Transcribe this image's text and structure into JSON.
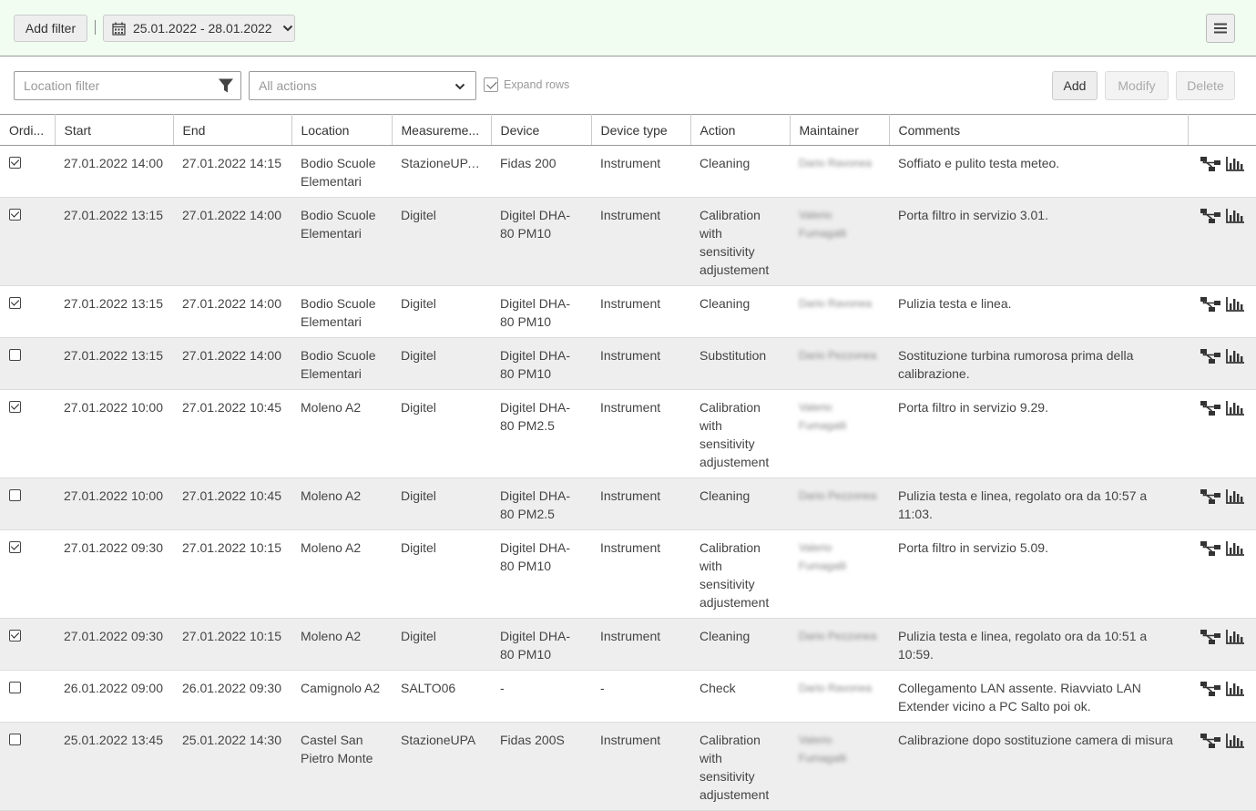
{
  "topbar": {
    "add_filter": "Add filter",
    "date_range": "25.01.2022 - 28.01.2022"
  },
  "toolbar": {
    "location_placeholder": "Location filter",
    "actions_value": "All actions",
    "expand_rows": "Expand rows",
    "add": "Add",
    "modify": "Modify",
    "delete": "Delete"
  },
  "columns": [
    "Ordi...",
    "Start",
    "End",
    "Location",
    "Measureme...",
    "Device",
    "Device type",
    "Action",
    "Maintainer",
    "Comments"
  ],
  "rows": [
    {
      "checked": true,
      "start": "27.01.2022 14:00",
      "end": "27.01.2022 14:15",
      "location": "Bodio Scuole Elementari",
      "measurement": "StazioneUPA...",
      "device": "Fidas 200",
      "device_type": "Instrument",
      "action": "Cleaning",
      "maintainer": "Dario Ravonea",
      "comments": "Soffiato e pulito testa meteo."
    },
    {
      "checked": true,
      "start": "27.01.2022 13:15",
      "end": "27.01.2022 14:00",
      "location": "Bodio Scuole Elementari",
      "measurement": "Digitel",
      "device": "Digitel DHA-80 PM10",
      "device_type": "Instrument",
      "action": "Calibration with sensitivity adjustement",
      "maintainer": "Valerio Fumagalli",
      "comments": "Porta filtro in servizio 3.01."
    },
    {
      "checked": true,
      "start": "27.01.2022 13:15",
      "end": "27.01.2022 14:00",
      "location": "Bodio Scuole Elementari",
      "measurement": "Digitel",
      "device": "Digitel DHA-80 PM10",
      "device_type": "Instrument",
      "action": "Cleaning",
      "maintainer": "Dario Ravonea",
      "comments": "Pulizia testa e linea."
    },
    {
      "checked": false,
      "start": "27.01.2022 13:15",
      "end": "27.01.2022 14:00",
      "location": "Bodio Scuole Elementari",
      "measurement": "Digitel",
      "device": "Digitel DHA-80 PM10",
      "device_type": "Instrument",
      "action": "Substitution",
      "maintainer": "Dario Pezzonea",
      "comments": "Sostituzione turbina rumorosa prima della calibrazione."
    },
    {
      "checked": true,
      "start": "27.01.2022 10:00",
      "end": "27.01.2022 10:45",
      "location": "Moleno A2",
      "measurement": "Digitel",
      "device": "Digitel DHA-80 PM2.5",
      "device_type": "Instrument",
      "action": "Calibration with sensitivity adjustement",
      "maintainer": "Valerio Fumagalli",
      "comments": "Porta filtro in servizio 9.29."
    },
    {
      "checked": false,
      "start": "27.01.2022 10:00",
      "end": "27.01.2022 10:45",
      "location": "Moleno A2",
      "measurement": "Digitel",
      "device": "Digitel DHA-80 PM2.5",
      "device_type": "Instrument",
      "action": "Cleaning",
      "maintainer": "Dario Pezzonea",
      "comments": "Pulizia testa e linea, regolato ora da 10:57 a 11:03."
    },
    {
      "checked": true,
      "start": "27.01.2022 09:30",
      "end": "27.01.2022 10:15",
      "location": "Moleno A2",
      "measurement": "Digitel",
      "device": "Digitel DHA-80 PM10",
      "device_type": "Instrument",
      "action": "Calibration with sensitivity adjustement",
      "maintainer": "Valerio Fumagalli",
      "comments": "Porta filtro in servizio 5.09."
    },
    {
      "checked": true,
      "start": "27.01.2022 09:30",
      "end": "27.01.2022 10:15",
      "location": "Moleno A2",
      "measurement": "Digitel",
      "device": "Digitel DHA-80 PM10",
      "device_type": "Instrument",
      "action": "Cleaning",
      "maintainer": "Dario Pezzonea",
      "comments": "Pulizia testa e linea, regolato ora da 10:51 a 10:59."
    },
    {
      "checked": false,
      "start": "26.01.2022 09:00",
      "end": "26.01.2022 09:30",
      "location": "Camignolo A2",
      "measurement": "SALTO06",
      "device": "-",
      "device_type": "-",
      "action": "Check",
      "maintainer": "Dario Ravonea",
      "comments": "Collegamento LAN assente. Riavviato LAN Extender vicino a PC Salto poi ok."
    },
    {
      "checked": false,
      "start": "25.01.2022 13:45",
      "end": "25.01.2022 14:30",
      "location": "Castel San Pietro Monte",
      "measurement": "StazioneUPA",
      "device": "Fidas 200S",
      "device_type": "Instrument",
      "action": "Calibration with sensitivity adjustement",
      "maintainer": "Valerio Fumagalli",
      "comments": "Calibrazione dopo sostituzione camera di misura"
    }
  ]
}
